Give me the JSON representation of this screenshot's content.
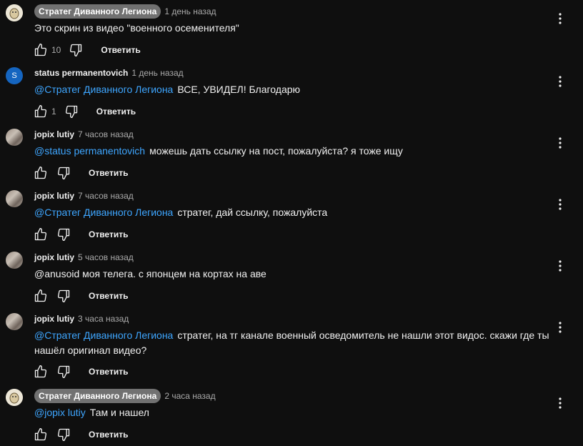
{
  "reply_label": "Ответить",
  "comments": [
    {
      "author": "Стратег Диванного Легиона",
      "owner": true,
      "time": "1 день назад",
      "mention": "",
      "text": "Это скрин из видео \"военного осеменителя\"",
      "likes": "10"
    },
    {
      "author": "status permanentovich",
      "owner": false,
      "avatar_letter": "S",
      "time": "1 день назад",
      "mention": "@Стратег Диванного Легиона",
      "text": "ВСЕ, УВИДЕЛ! Благодарю",
      "likes": "1"
    },
    {
      "author": "jopix lutiy",
      "owner": false,
      "time": "7 часов назад",
      "mention": "@status permanentovich",
      "text": "можешь дать ссылку на пост, пожалуйста? я тоже ищу",
      "likes": ""
    },
    {
      "author": "jopix lutiy",
      "owner": false,
      "time": "7 часов назад",
      "mention": "@Стратег Диванного Легиона",
      "text": "стратег, дай ссылку, пожалуйста",
      "likes": ""
    },
    {
      "author": "jopix lutiy",
      "owner": false,
      "time": "5 часов назад",
      "mention": "",
      "text": "@anusoid моя телега. с японцем на кортах на аве",
      "likes": ""
    },
    {
      "author": "jopix lutiy",
      "owner": false,
      "time": "3 часа назад",
      "mention": "@Стратег Диванного Легиона",
      "text": "стратег, на тг канале военный осведомитель не нашли этот видос. скажи где ты нашёл оригинал видео?",
      "likes": ""
    },
    {
      "author": "Стратег Диванного Легиона",
      "owner": true,
      "time": "2 часа назад",
      "mention": "@jopix lutiy",
      "text": "Там и нашел",
      "likes": ""
    }
  ]
}
